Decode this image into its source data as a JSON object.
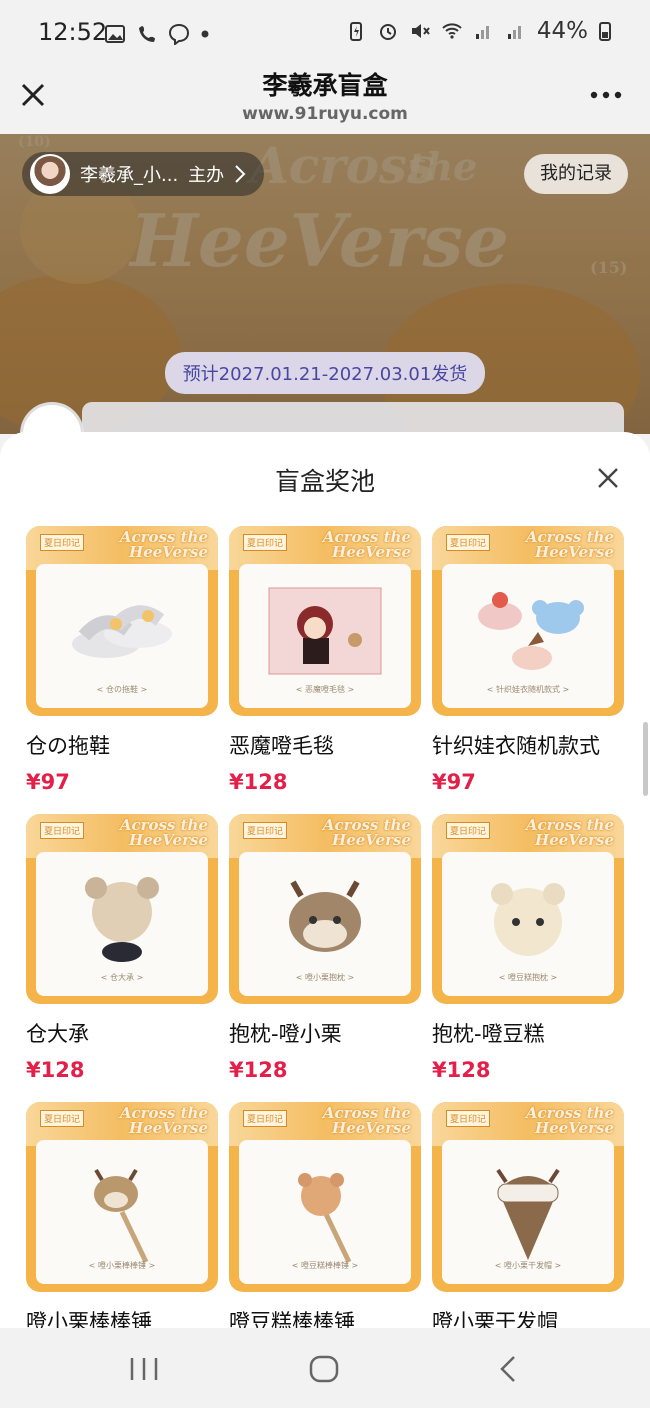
{
  "status_bar": {
    "time": "12:52",
    "battery": "44%"
  },
  "header": {
    "title": "李羲承盲盒",
    "url": "www.91ruyu.com"
  },
  "banner": {
    "host_name": "李羲承_小...",
    "host_role": "主办",
    "record_label": "我的记录",
    "ship_date": "预计2027.01.21-2027.03.01发货",
    "art_text_1": "Across",
    "art_text_2": "the",
    "art_text_3": "HeeVerse",
    "art_num_left": "(10)",
    "art_num_right": "(15)"
  },
  "sheet": {
    "title": "盲盒奖池",
    "brand_line_1": "Across the",
    "brand_line_2": "HeeVerse",
    "stamp": "夏日印记",
    "items": [
      {
        "name": "仓の拖鞋",
        "price": "¥97",
        "caption": "< 仓の拖鞋 >",
        "icon": "slippers"
      },
      {
        "name": "恶魔噔毛毯",
        "price": "¥128",
        "caption": "< 恶魔噔毛毯 >",
        "icon": "blanket"
      },
      {
        "name": "针织娃衣随机款式",
        "price": "¥97",
        "caption": "< 针织娃衣随机款式 >",
        "icon": "knit-hats"
      },
      {
        "name": "仓大承",
        "price": "¥128",
        "caption": "< 仓大承 >",
        "icon": "plush-blurred"
      },
      {
        "name": "抱枕-噔小栗",
        "price": "¥128",
        "caption": "< 噔小栗抱枕 >",
        "icon": "deer-pillow-blurred"
      },
      {
        "name": "抱枕-噔豆糕",
        "price": "¥128",
        "caption": "< 噔豆糕抱枕 >",
        "icon": "bear-pillow-blurred"
      },
      {
        "name": "噔小栗棒棒锤",
        "price": "",
        "caption": "< 噔小栗棒棒锤 >",
        "icon": "deer-hammer"
      },
      {
        "name": "噔豆糕棒棒锤",
        "price": "",
        "caption": "< 噔豆糕棒棒锤 >",
        "icon": "bear-hammer"
      },
      {
        "name": "噔小栗干发帽",
        "price": "",
        "caption": "< 噔小栗干发帽 >",
        "icon": "hair-cap"
      }
    ]
  },
  "colors": {
    "price": "#e4204a",
    "ship_text": "#4a47a3",
    "orange": "#f5b44a"
  }
}
